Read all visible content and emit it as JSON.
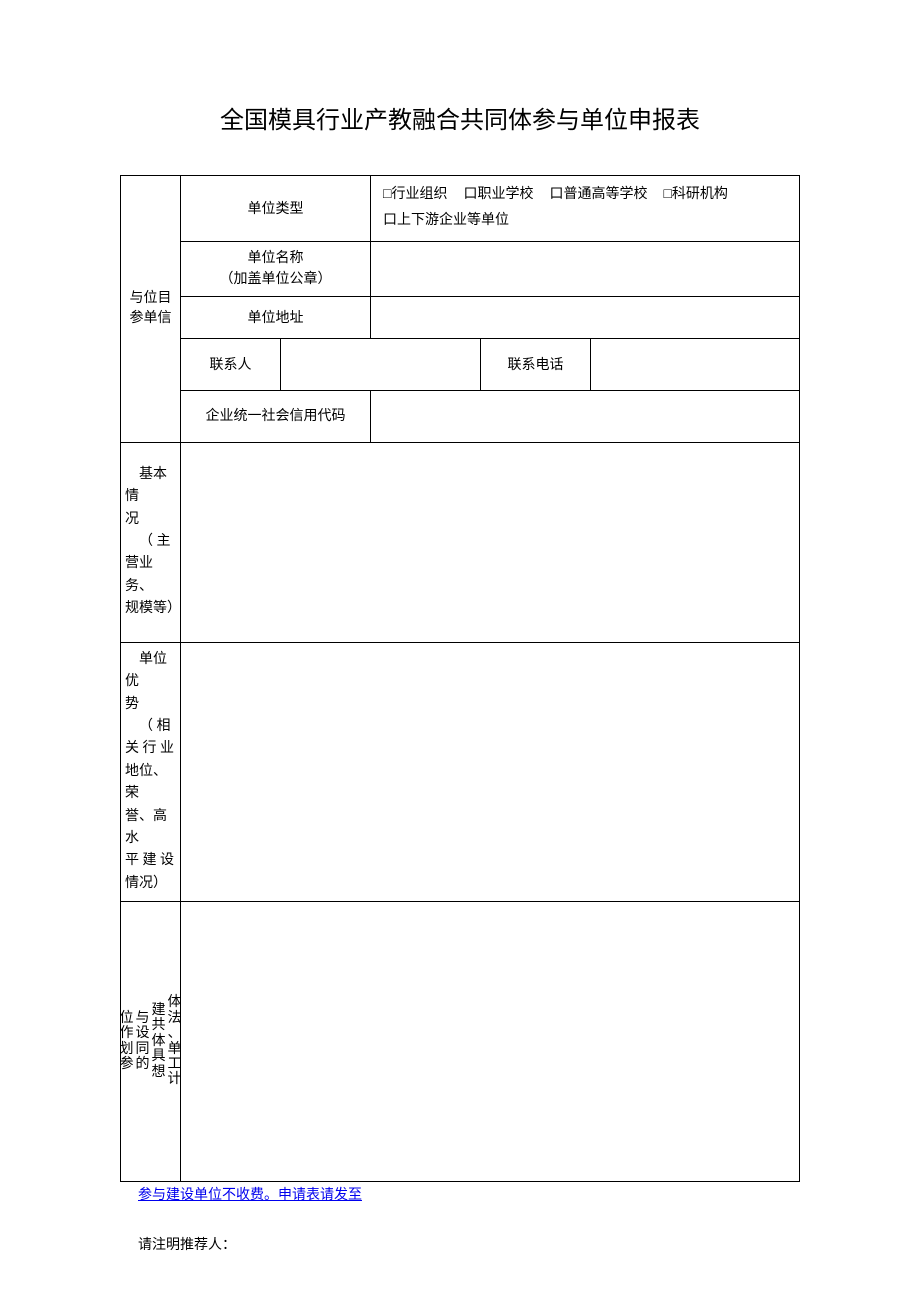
{
  "title": "全国模具行业产教融合共同体参与单位申报表",
  "section1": {
    "header": "与位目参单信",
    "unit_type_label": "单位类型",
    "unit_type_options": {
      "opt1": "□行业组织",
      "opt2": "口职业学校",
      "opt3": "口普通高等学校",
      "opt4": "□科研机构",
      "opt5": "口上下游企业等单位"
    },
    "unit_name_label_line1": "单位名称",
    "unit_name_label_line2": "（加盖单位公章）",
    "unit_name_value": "",
    "unit_address_label": "单位地址",
    "unit_address_value": "",
    "contact_label": "联系人",
    "contact_value": "",
    "phone_label": "联系电话",
    "phone_value": "",
    "credit_code_label": "企业统一社会信用代码",
    "credit_code_value": ""
  },
  "section2": {
    "label": "　基本情况\n　（ 主营业务、规模等）",
    "value": ""
  },
  "section3": {
    "label": "　单位优势\n　（ 相关行业地位、荣誉、高水平建设情况）",
    "value": ""
  },
  "section4": {
    "col1": "位作划参",
    "col2": "与设同的",
    "col3": "建共体具想",
    "col4": "体法、单工计",
    "value": ""
  },
  "footer": {
    "link": "参与建设单位不收费。申请表请发至",
    "note": "请注明推荐人："
  }
}
